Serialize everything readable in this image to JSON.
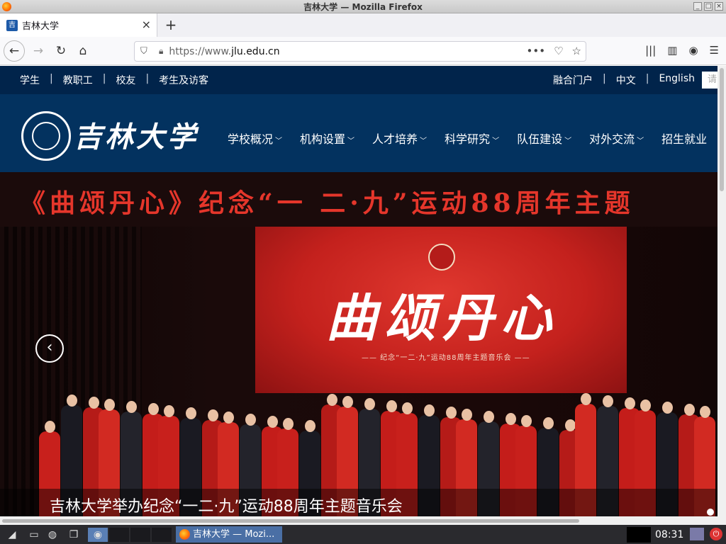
{
  "window": {
    "title": "吉林大学 — Mozilla Firefox"
  },
  "tabs": [
    {
      "label": "吉林大学"
    }
  ],
  "navbar": {
    "url_prefix": "https://www.",
    "url_domain": "jlu.edu.cn"
  },
  "utility_bar": {
    "left_links": [
      "学生",
      "教职工",
      "校友",
      "考生及访客"
    ],
    "right_links": [
      "融合门户",
      "中文",
      "English"
    ],
    "search_placeholder": "请"
  },
  "header": {
    "logo_name": "吉林大学",
    "menu": [
      "学校概况",
      "机构设置",
      "人才培养",
      "科学研究",
      "队伍建设",
      "对外交流",
      "招生就业"
    ]
  },
  "banner": {
    "headline": "《曲颂丹心》纪念“一 二·九”运动88周年主题",
    "screen_title": "曲颂丹心",
    "screen_subtitle": "—— 纪念“一二·九”运动88周年主题音乐会 ——",
    "caption": "吉林大学举办纪念“一二·九”运动88周年主题音乐会",
    "slide_count": 1
  },
  "taskbar": {
    "window_label": "吉林大学 — Mozi...",
    "clock": "08:31"
  },
  "colors": {
    "header_bg": "#03325f",
    "util_bg": "#01244b",
    "headline_red": "#e5362b"
  }
}
